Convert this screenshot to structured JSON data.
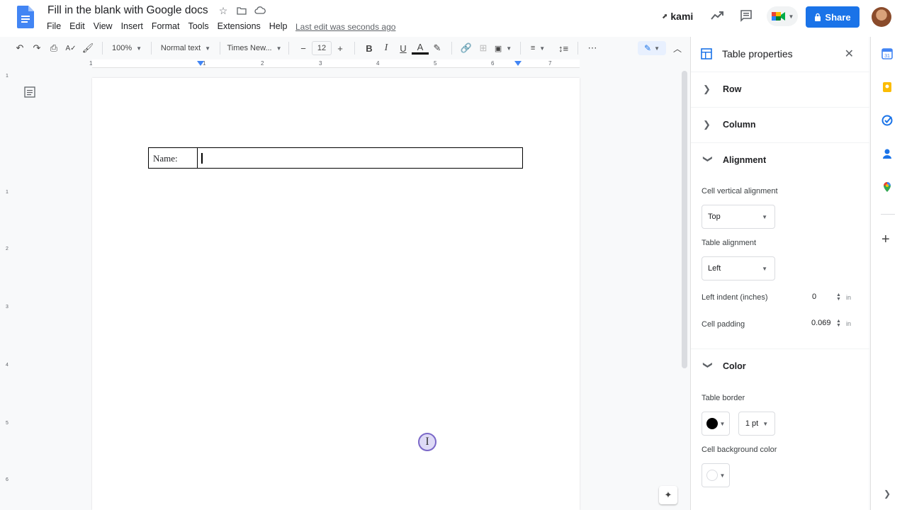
{
  "header": {
    "doc_title": "Fill in the blank with Google docs",
    "last_edit": "Last edit was seconds ago",
    "menu": [
      "File",
      "Edit",
      "View",
      "Insert",
      "Format",
      "Tools",
      "Extensions",
      "Help"
    ],
    "kami_label": "kami",
    "share_label": "Share"
  },
  "toolbar": {
    "zoom": "100%",
    "style": "Normal text",
    "font": "Times New...",
    "font_size": "12"
  },
  "ruler": {
    "numbers": [
      "1",
      "1",
      "2",
      "3",
      "4",
      "5",
      "6",
      "7"
    ]
  },
  "vruler": {
    "numbers": [
      "1",
      "1",
      "2",
      "3",
      "4",
      "5",
      "6"
    ]
  },
  "document": {
    "table_label": "Name:"
  },
  "panel": {
    "title": "Table properties",
    "sections": {
      "row": "Row",
      "column": "Column",
      "alignment": "Alignment",
      "color": "Color"
    },
    "cell_vertical_alignment_label": "Cell vertical alignment",
    "cell_vertical_alignment_value": "Top",
    "table_alignment_label": "Table alignment",
    "table_alignment_value": "Left",
    "left_indent_label": "Left indent (inches)",
    "left_indent_value": "0",
    "cell_padding_label": "Cell padding",
    "cell_padding_value": "0.069",
    "unit": "in",
    "table_border_label": "Table border",
    "border_color": "#000000",
    "border_width": "1 pt",
    "cell_bg_label": "Cell background color",
    "cell_bg_color": "#ffffff"
  },
  "colors": {
    "accent": "#1a73e8",
    "docs_blue": "#4285f4"
  }
}
